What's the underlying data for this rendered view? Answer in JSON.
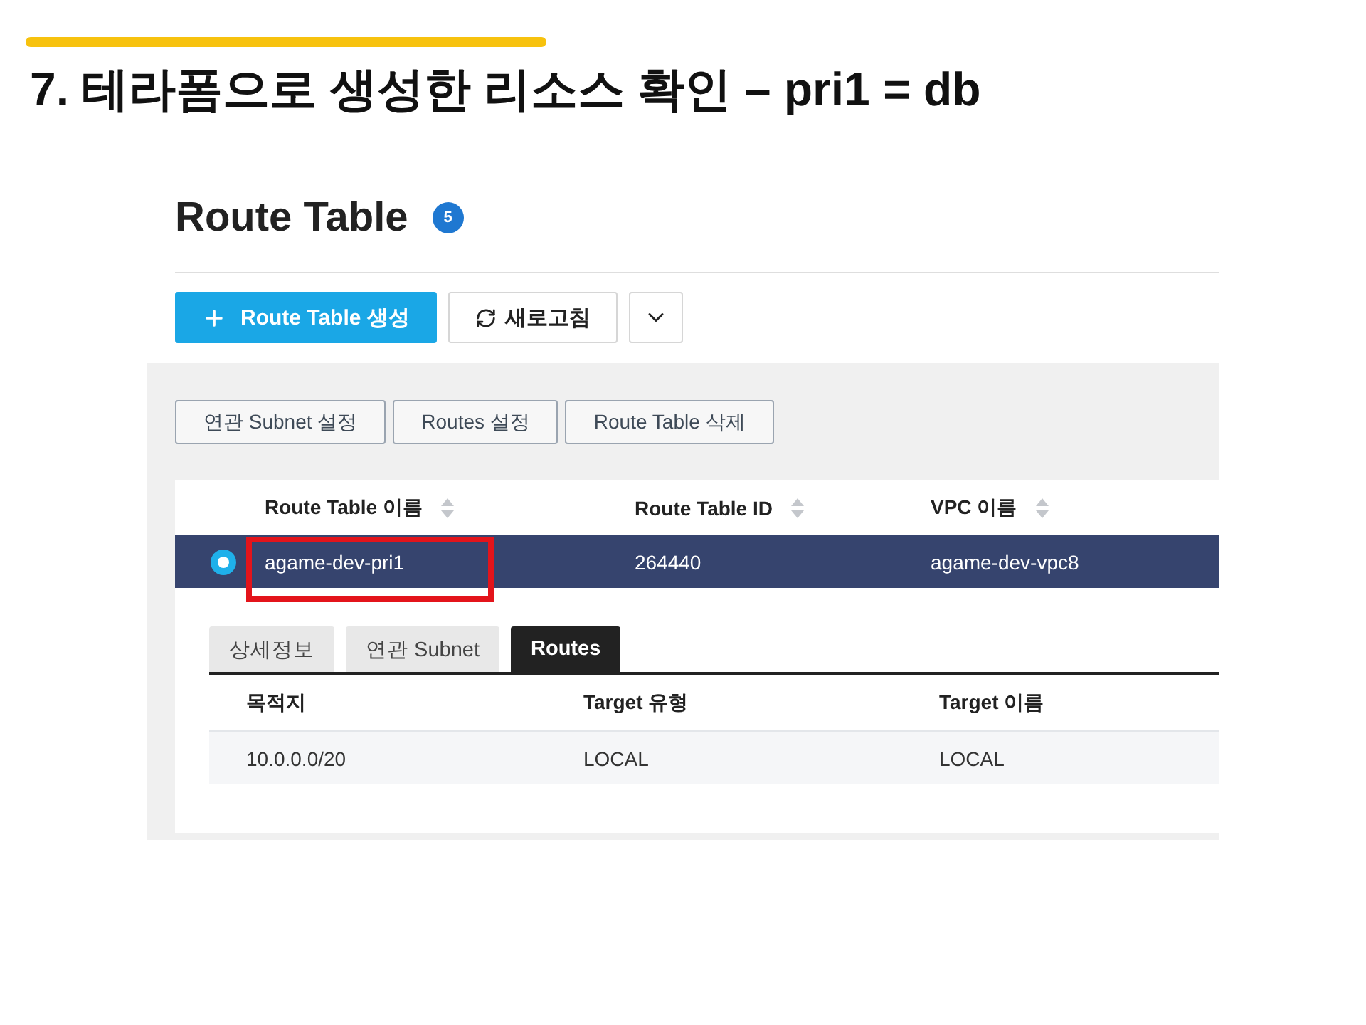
{
  "slide": {
    "title": "7. 테라폼으로 생성한 리소스 확인 – pri1 = db"
  },
  "header": {
    "title": "Route Table",
    "count": "5"
  },
  "toolbar": [
    {
      "kind": "create",
      "label": "Route Table 생성"
    },
    {
      "kind": "refresh",
      "label": "새로고침"
    },
    {
      "kind": "more"
    }
  ],
  "actions": [
    {
      "label": "연관 Subnet 설정"
    },
    {
      "label": "Routes 설정"
    },
    {
      "label": "Route Table 삭제"
    }
  ],
  "table": {
    "columns": [
      {
        "label": "Route Table 이름",
        "sortable": true
      },
      {
        "label": "Route Table ID",
        "sortable": true
      },
      {
        "label": "VPC 이름",
        "sortable": true
      }
    ],
    "rows": [
      {
        "selected": true,
        "cells": [
          {
            "text": "agame-dev-pri1",
            "highlighted": true
          },
          {
            "text": "264440",
            "highlighted": false
          },
          {
            "text": "agame-dev-vpc8",
            "highlighted": false
          }
        ]
      }
    ]
  },
  "detail_tabs": [
    {
      "label": "상세정보",
      "selected": false
    },
    {
      "label": "연관 Subnet",
      "selected": false
    },
    {
      "label": "Routes",
      "selected": true
    }
  ],
  "routes": {
    "columns": [
      "목적지",
      "Target 유형",
      "Target 이름"
    ],
    "rows": [
      [
        "10.0.0.0/20",
        "LOCAL",
        "LOCAL"
      ]
    ]
  }
}
